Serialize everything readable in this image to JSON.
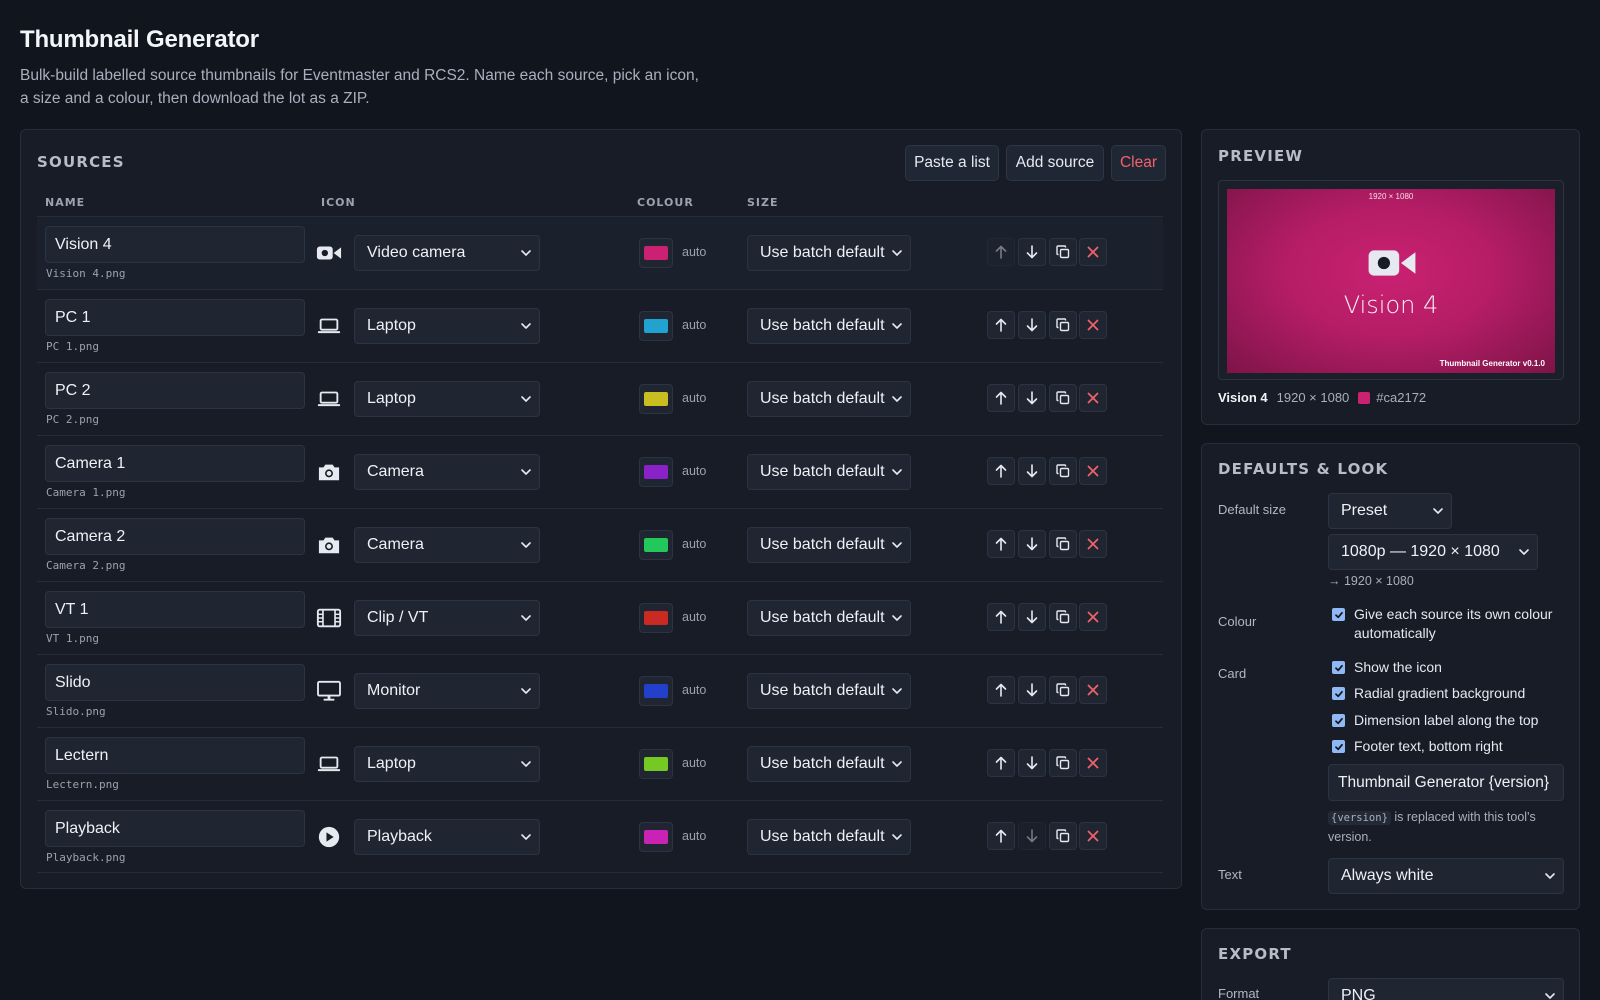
{
  "header": {
    "title": "Thumbnail Generator",
    "subtitle": "Bulk-build labelled source thumbnails for Eventmaster and RCS2. Name each source, pick an icon, a size and a colour, then download the lot as a ZIP."
  },
  "sources": {
    "heading": "SOURCES",
    "buttons": {
      "paste": "Paste a list",
      "add": "Add source",
      "clear": "Clear"
    },
    "columns": {
      "name": "NAME",
      "icon": "ICON",
      "colour": "COLOUR",
      "size": "SIZE"
    },
    "auto_label": "auto",
    "rows": [
      {
        "name": "Vision 4",
        "file": "Vision 4.png",
        "icon": "video-camera",
        "icon_label": "Video camera",
        "colour": "#ca2172",
        "size": "Use batch default"
      },
      {
        "name": "PC 1",
        "file": "PC 1.png",
        "icon": "laptop",
        "icon_label": "Laptop",
        "colour": "#22a2d0",
        "size": "Use batch default"
      },
      {
        "name": "PC 2",
        "file": "PC 2.png",
        "icon": "laptop",
        "icon_label": "Laptop",
        "colour": "#c9bd22",
        "size": "Use batch default"
      },
      {
        "name": "Camera 1",
        "file": "Camera 1.png",
        "icon": "camera",
        "icon_label": "Camera",
        "colour": "#8b22c9",
        "size": "Use batch default"
      },
      {
        "name": "Camera 2",
        "file": "Camera 2.png",
        "icon": "camera",
        "icon_label": "Camera",
        "colour": "#22c95a",
        "size": "Use batch default"
      },
      {
        "name": "VT 1",
        "file": "VT 1.png",
        "icon": "film",
        "icon_label": "Clip / VT",
        "colour": "#c92b22",
        "size": "Use batch default"
      },
      {
        "name": "Slido",
        "file": "Slido.png",
        "icon": "monitor",
        "icon_label": "Monitor",
        "colour": "#2240c9",
        "size": "Use batch default"
      },
      {
        "name": "Lectern",
        "file": "Lectern.png",
        "icon": "laptop",
        "icon_label": "Laptop",
        "colour": "#76c922",
        "size": "Use batch default"
      },
      {
        "name": "Playback",
        "file": "Playback.png",
        "icon": "play",
        "icon_label": "Playback",
        "colour": "#c922b4",
        "size": "Use batch default"
      }
    ]
  },
  "preview": {
    "heading": "PREVIEW",
    "card_dimension": "1920 × 1080",
    "card_name": "Vision 4",
    "card_footer": "Thumbnail Generator v0.1.0",
    "card_colour": "#ca2172",
    "meta_name": "Vision 4",
    "meta_dims": "1920 × 1080",
    "meta_hex": "#ca2172"
  },
  "defaults": {
    "heading": "DEFAULTS & LOOK",
    "default_size_label": "Default size",
    "size_mode": "Preset",
    "size_preset": "1080p — 1920 × 1080",
    "size_result": "→ 1920 × 1080",
    "colour_label": "Colour",
    "colour_auto": "Give each source its own colour automatically",
    "card_label": "Card",
    "card_opts": [
      "Show the icon",
      "Radial gradient background",
      "Dimension label along the top",
      "Footer text, bottom right"
    ],
    "footer_text": "Thumbnail Generator {version}",
    "footer_hint_code": "{version}",
    "footer_hint": " is replaced with this tool's version.",
    "text_label": "Text",
    "text_value": "Always white"
  },
  "export": {
    "heading": "EXPORT",
    "format_label": "Format",
    "format_value": "PNG"
  }
}
